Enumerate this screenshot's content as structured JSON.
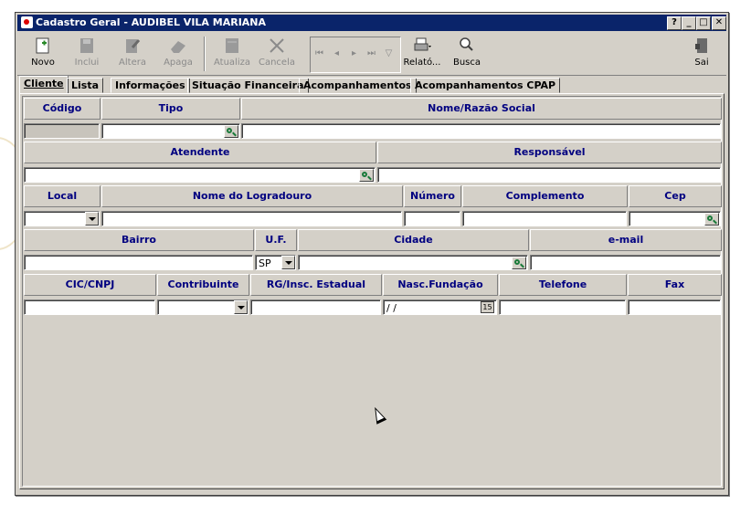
{
  "window": {
    "title": "Cadastro Geral - AUDIBEL VILA MARIANA",
    "controls": {
      "help": "?",
      "minimize": "_",
      "maximize": "□",
      "close": "✕"
    }
  },
  "toolbar": {
    "novo": "Novo",
    "inclui": "Inclui",
    "altera": "Altera",
    "apaga": "Apaga",
    "atualiza": "Atualiza",
    "cancela": "Cancela",
    "relatorio": "Relató...",
    "busca": "Busca",
    "sai": "Sai",
    "nav": {
      "first": "⏮",
      "prev": "◂",
      "next": "▸",
      "last": "⏭",
      "filter": "▽"
    }
  },
  "tabs": [
    "Cliente",
    "Lista",
    "Informações",
    "Situação Financeira",
    "Acompanhamentos",
    "Acompanhamentos CPAP"
  ],
  "form": {
    "labels": {
      "codigo": "Código",
      "tipo": "Tipo",
      "nome": "Nome/Razão Social",
      "atendente": "Atendente",
      "responsavel": "Responsável",
      "local": "Local",
      "logradouro": "Nome do Logradouro",
      "numero": "Número",
      "complemento": "Complemento",
      "cep": "Cep",
      "bairro": "Bairro",
      "uf": "U.F.",
      "cidade": "Cidade",
      "email": "e-mail",
      "cic": "CIC/CNPJ",
      "contribuinte": "Contribuinte",
      "rg": "RG/Insc. Estadual",
      "nascimento": "Nasc.Fundação",
      "telefone": "Telefone",
      "fax": "Fax"
    },
    "values": {
      "uf": "SP",
      "nascimento": "/ /",
      "calendar_day": "15"
    }
  }
}
